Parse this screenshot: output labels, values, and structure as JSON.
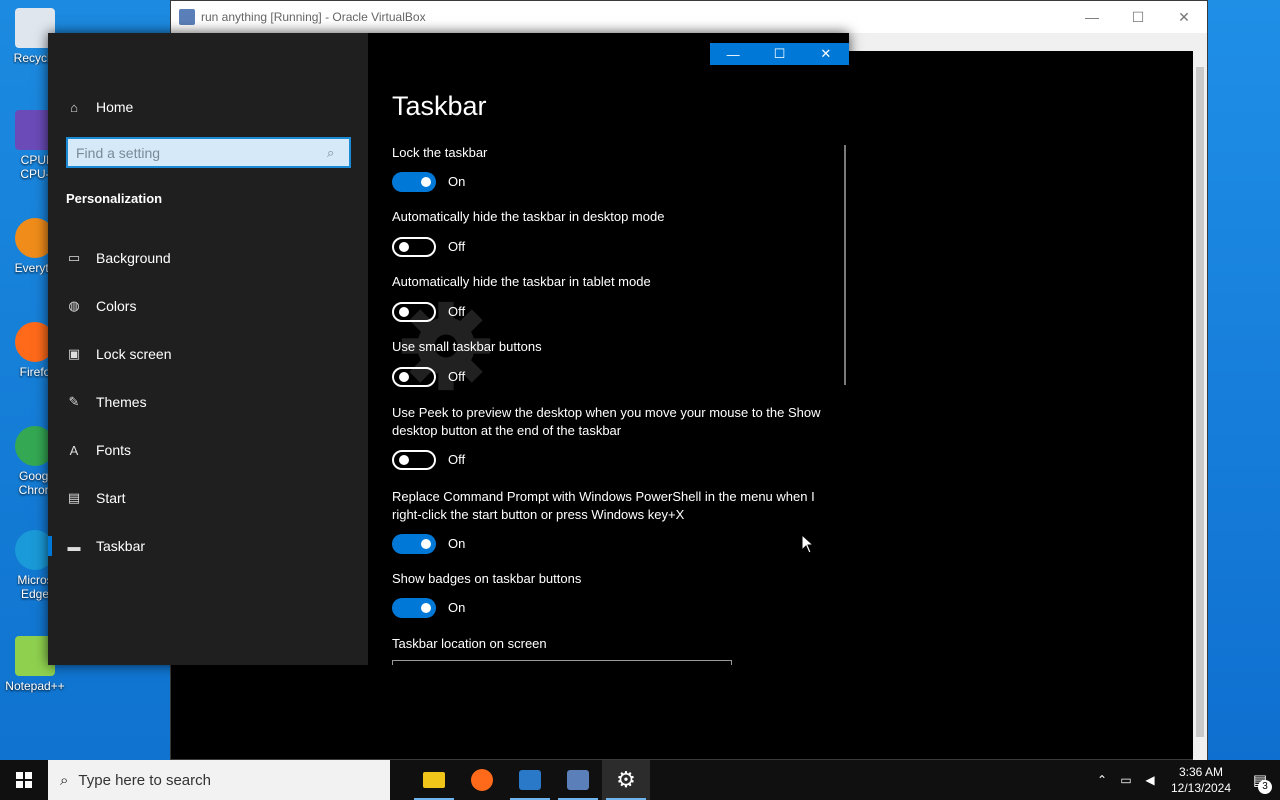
{
  "desktop": {
    "icons": [
      {
        "label": "Recycle",
        "color": "#dfe6ee"
      },
      {
        "label": "CPUI",
        "label2": "CPU-",
        "color": "#6b4bb8"
      },
      {
        "label": "Everyth",
        "color": "#f08c1a"
      },
      {
        "label": "Firefo",
        "color": "#ff6a1a"
      },
      {
        "label": "Googl",
        "label2": "Chron",
        "color": "#34a853"
      },
      {
        "label": "Micros",
        "label2": "Edge",
        "color": "#1a9ad8"
      },
      {
        "label": "Notepad++",
        "color": "#8fd14f"
      }
    ]
  },
  "vbox": {
    "title": "run anything [Running] - Oracle VirtualBox",
    "min_glyph": "—",
    "max_glyph": "☐",
    "close_glyph": "✕"
  },
  "settings": {
    "window_controls": {
      "min": "—",
      "max": "☐",
      "close": "✕"
    },
    "sidebar": {
      "home_label": "Home",
      "search_placeholder": "Find a setting",
      "section": "Personalization",
      "items": [
        {
          "label": "Background",
          "icon": "picture-icon"
        },
        {
          "label": "Colors",
          "icon": "palette-icon"
        },
        {
          "label": "Lock screen",
          "icon": "lock-screen-icon"
        },
        {
          "label": "Themes",
          "icon": "brush-icon"
        },
        {
          "label": "Fonts",
          "icon": "font-icon"
        },
        {
          "label": "Start",
          "icon": "start-icon"
        },
        {
          "label": "Taskbar",
          "icon": "taskbar-icon",
          "active": true
        }
      ]
    },
    "page_title": "Taskbar",
    "accent": "#0078d7",
    "options": [
      {
        "label": "Lock the taskbar",
        "state": "On"
      },
      {
        "label": "Automatically hide the taskbar in desktop mode",
        "state": "Off"
      },
      {
        "label": "Automatically hide the taskbar in tablet mode",
        "state": "Off"
      },
      {
        "label": "Use small taskbar buttons",
        "state": "Off"
      },
      {
        "label": "Use Peek to preview the desktop when you move your mouse to the Show desktop button at the end of the taskbar",
        "state": "Off"
      },
      {
        "label": "Replace Command Prompt with Windows PowerShell in the menu when I right-click the start button or press Windows key+X",
        "state": "On"
      },
      {
        "label": "Show badges on taskbar buttons",
        "state": "On"
      }
    ],
    "location_label": "Taskbar location on screen"
  },
  "taskbar": {
    "search_placeholder": "Type here to search",
    "apps": [
      {
        "name": "file-explorer",
        "color": "#f0c419"
      },
      {
        "name": "firefox",
        "color": "#ff6a1a"
      },
      {
        "name": "virtualbox",
        "color": "#2a78c8"
      },
      {
        "name": "vm-window",
        "color": "#5b7fb8"
      },
      {
        "name": "settings",
        "color": "#ffffff",
        "active": true
      }
    ],
    "time": "3:36 AM",
    "date": "12/13/2024",
    "notifications": "3"
  }
}
